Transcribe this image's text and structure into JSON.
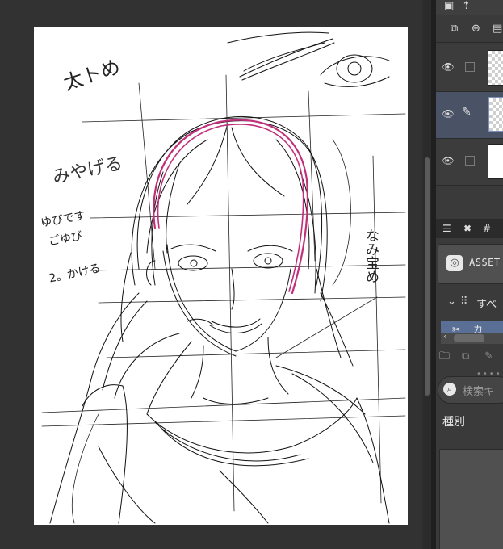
{
  "panel": {
    "tabs": [
      "☰",
      "✖",
      "#"
    ],
    "asset_header": {
      "label": "ASSET"
    },
    "category": {
      "label": "すべ"
    },
    "sub_category_label": "カ",
    "search": {
      "placeholder": "検索キ"
    },
    "kind_label": "種別",
    "layers": [
      {
        "type": "raster",
        "visible": true,
        "locked": false,
        "selected": false
      },
      {
        "type": "raster",
        "visible": true,
        "editing": true,
        "selected": true
      },
      {
        "type": "paper",
        "visible": true,
        "locked": false,
        "selected": false
      }
    ]
  },
  "canvas": {
    "annotations": {
      "top_left": "太トめ",
      "left_mid": "みやげる",
      "left_note_1": "ゆびです",
      "left_note_2": "ごゆび",
      "left_note_3": "2。かける",
      "right_note": "なみ宝め"
    },
    "colors": {
      "sketch": "#111111",
      "headband": "#c0307a",
      "paper": "#ffffff"
    }
  }
}
